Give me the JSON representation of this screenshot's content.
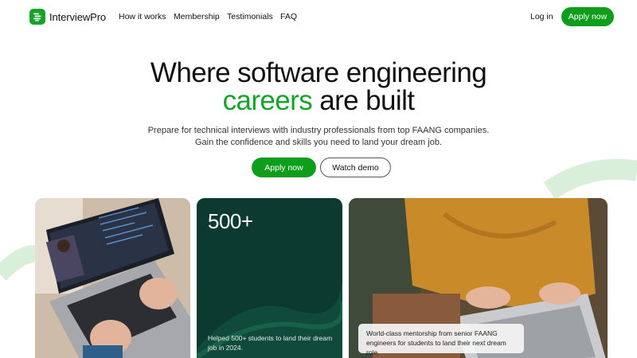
{
  "brand": {
    "name": "InterviewPro",
    "accent": "#15a32a",
    "button": "#0f9d1c",
    "logo_icon": "stacked-lines-icon"
  },
  "nav": {
    "items": [
      {
        "label": "How it works"
      },
      {
        "label": "Membership"
      },
      {
        "label": "Testimonials"
      },
      {
        "label": "FAQ"
      }
    ],
    "login": "Log in",
    "apply": "Apply now"
  },
  "hero": {
    "title_line1": "Where software engineering",
    "title_accent": "careers",
    "title_rest": " are built",
    "subtitle_line1": "Prepare for technical interviews with industry professionals from top FAANG companies.",
    "subtitle_line2": "Gain the confidence and skills you need to land your dream job.",
    "primary_cta": "Apply now",
    "secondary_cta": "Watch demo"
  },
  "cards": {
    "stat_value": "500+",
    "stat_caption": "Helped 500+ students to land their dream job in 2024.",
    "mentor_caption": "World-class mentorship from senior FAANG engineers for students to land their next dream role"
  }
}
